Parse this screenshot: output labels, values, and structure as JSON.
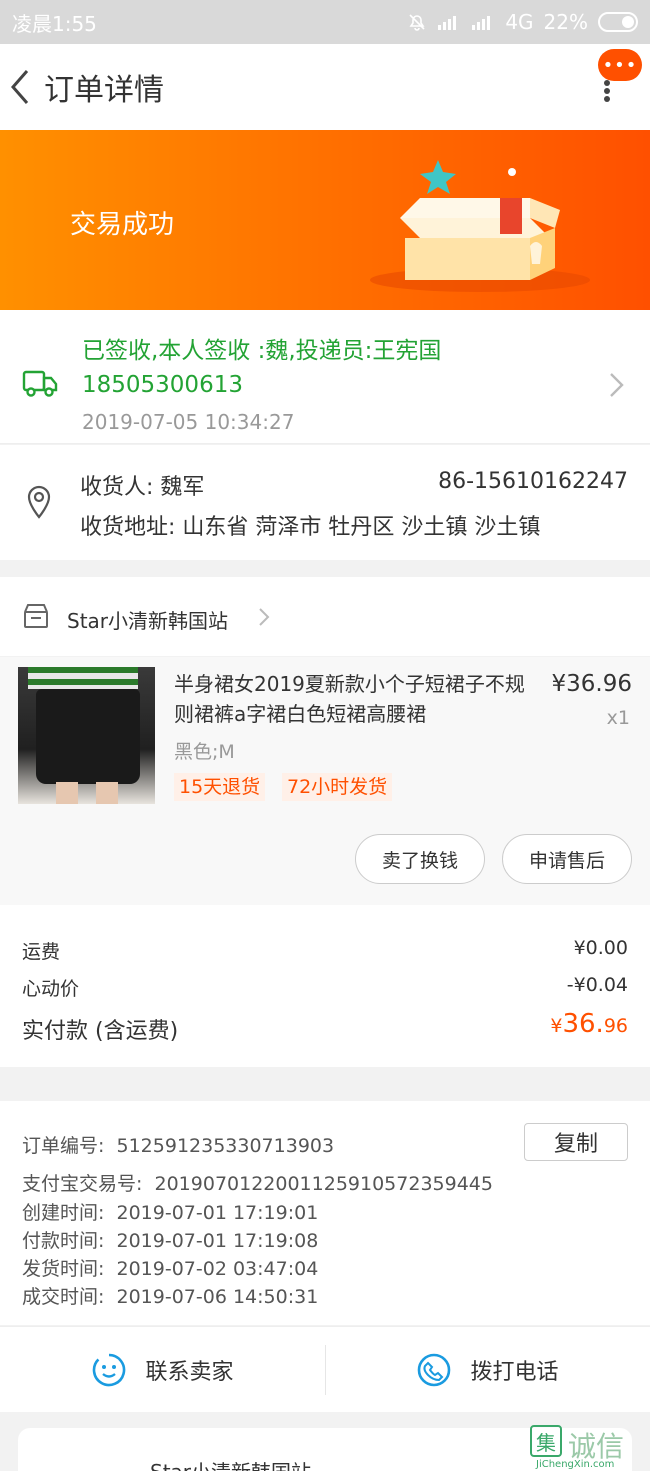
{
  "status_bar": {
    "time": "凌晨1:55",
    "network": "4G",
    "battery": "22%"
  },
  "nav": {
    "title": "订单详情",
    "badge": "•••"
  },
  "banner": {
    "status_text": "交易成功"
  },
  "logistics": {
    "message": "已签收,本人签收 :魏,投递员:王宪国 18505300613",
    "time": "2019-07-05 10:34:27"
  },
  "address": {
    "name": "收货人: 魏军",
    "phone": "86-15610162247",
    "line": "收货地址: 山东省 菏泽市 牡丹区 沙土镇 沙土镇"
  },
  "shop": {
    "name": "Star小清新韩国站"
  },
  "item": {
    "title": "半身裙女2019夏新款小个子短裙子不规则裙裤a字裙白色短裙高腰裙",
    "price": "¥36.96",
    "qty": "x1",
    "sku": "黑色;M",
    "tags": [
      "15天退货",
      "72小时发货"
    ],
    "buttons": [
      "卖了换钱",
      "申请售后"
    ]
  },
  "fees": {
    "shipping_label": "运费",
    "shipping_value": "¥0.00",
    "discount_label": "心动价",
    "discount_value": "-¥0.04",
    "paid_label": "实付款 (含运费)",
    "paid_currency": "¥",
    "paid_int": "36.",
    "paid_dec": "96"
  },
  "order_info": {
    "copy_label": "复制",
    "rows": [
      {
        "label": "订单编号:",
        "value": "512591235330713903"
      },
      {
        "label": "支付宝交易号:",
        "value": "2019070122001125910572359445"
      },
      {
        "label": "创建时间:",
        "value": "2019-07-01 17:19:01"
      },
      {
        "label": "付款时间:",
        "value": "2019-07-01 17:19:08"
      },
      {
        "label": "发货时间:",
        "value": "2019-07-02 03:47:04"
      },
      {
        "label": "成交时间:",
        "value": "2019-07-06 14:50:31"
      }
    ]
  },
  "actions": {
    "contact_seller": "联系卖家",
    "call_phone": "拨打电话"
  },
  "bottom_card": {
    "shop_name": "Star小清新韩国站"
  },
  "watermark": {
    "logo_char": "集",
    "text": "诚信",
    "url": "JiChengXin.com"
  }
}
